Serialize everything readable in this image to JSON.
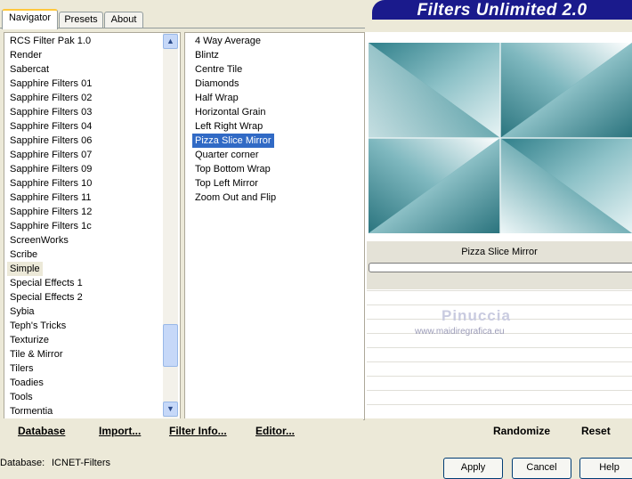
{
  "tabs": [
    "Navigator",
    "Presets",
    "About"
  ],
  "app_title": "Filters Unlimited 2.0",
  "categories": [
    "RCS Filter Pak 1.0",
    "Render",
    "Sabercat",
    "Sapphire Filters 01",
    "Sapphire Filters 02",
    "Sapphire Filters 03",
    "Sapphire Filters 04",
    "Sapphire Filters 06",
    "Sapphire Filters 07",
    "Sapphire Filters 09",
    "Sapphire Filters 10",
    "Sapphire Filters 11",
    "Sapphire Filters 12",
    "Sapphire Filters 1c",
    "ScreenWorks",
    "Scribe",
    "Simple",
    "Special Effects 1",
    "Special Effects 2",
    "Sybia",
    "Teph's Tricks",
    "Texturize",
    "Tile & Mirror",
    "Tilers",
    "Toadies",
    "Tools",
    "Tormentia"
  ],
  "selected_category": "Simple",
  "filters": [
    "4 Way Average",
    "Blintz",
    "Centre Tile",
    "Diamonds",
    "Half Wrap",
    "Horizontal Grain",
    "Left Right Wrap",
    "Pizza Slice Mirror",
    "Quarter corner",
    "Top Bottom Wrap",
    "Top Left Mirror",
    "Zoom Out and Flip"
  ],
  "selected_filter": "Pizza Slice Mirror",
  "preview": {
    "filter_name": "Pizza Slice Mirror"
  },
  "watermark": {
    "name": "Pinuccia",
    "url": "www.maidiregrafica.eu"
  },
  "toolbar": {
    "database": "Database",
    "import": "Import...",
    "filter_info": "Filter Info...",
    "editor": "Editor...",
    "randomize": "Randomize",
    "reset": "Reset"
  },
  "status": {
    "label": "Database:",
    "value": "ICNET-Filters"
  },
  "dialog_buttons": {
    "apply": "Apply",
    "cancel": "Cancel",
    "help": "Help"
  },
  "colors": {
    "title_bar": "#1a1a8c",
    "selection": "#316ac5",
    "preview_teal": "#2f7f8a",
    "tab_accent": "#ffc83c"
  }
}
